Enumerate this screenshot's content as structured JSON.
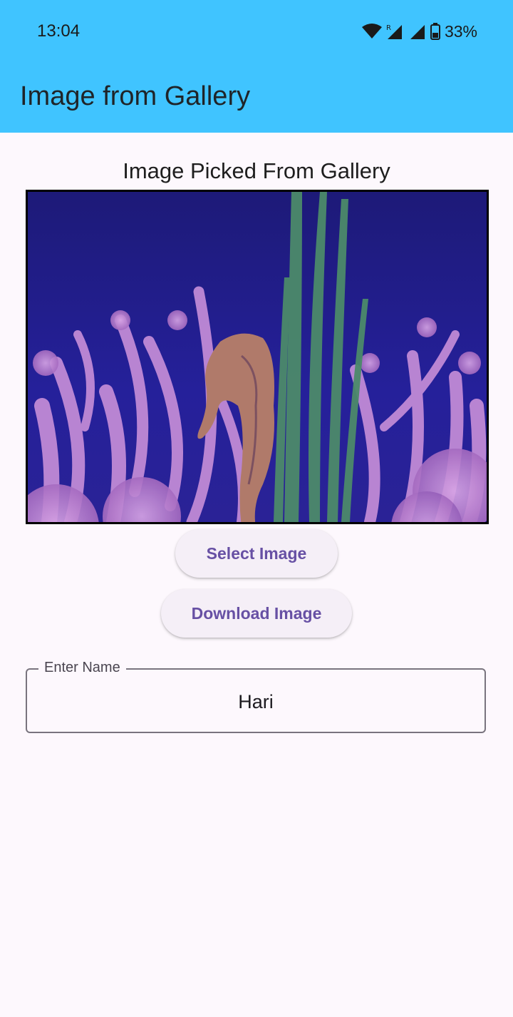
{
  "status_bar": {
    "time": "13:04",
    "battery": "33%",
    "icons": [
      "wifi-icon",
      "signal-icon",
      "signal-icon",
      "battery-icon"
    ]
  },
  "app_bar": {
    "title": "Image from Gallery",
    "color": "#40c4ff"
  },
  "main": {
    "section_title": "Image Picked From Gallery",
    "image_description_name": "picked-image",
    "select_button": "Select Image",
    "download_button": "Download Image",
    "name_field": {
      "label": "Enter Name",
      "value": "Hari"
    }
  },
  "colors": {
    "accent": "#6750a4",
    "background": "#fdf8fd"
  }
}
